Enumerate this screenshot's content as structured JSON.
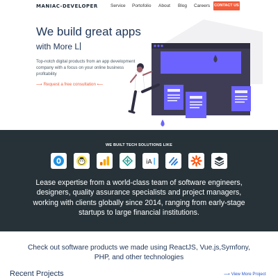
{
  "nav": {
    "brand": "MANIAC-DEVELOPER",
    "links": [
      "Service",
      "Portofolio",
      "About",
      "Blog",
      "Careers"
    ],
    "cta": "CONTACT US"
  },
  "hero": {
    "title": "We build great apps",
    "subtitle": "with More L",
    "description": "Top-notch digital products from an app development company with a focus on your online business profitability",
    "consult_link": "⟶ Request a free consultation ⟵"
  },
  "tech": {
    "heading": "WE BUILT TECH SOLUTIONS LIKE",
    "logos": [
      "dealerinspire-logo",
      "mailchimp-logo",
      "google-analytics-logo",
      "jsonformatter-logo",
      "ia-writer-logo",
      "blue-stripes-logo",
      "zapier-logo",
      "stack-logo"
    ],
    "text": "Lease expertise from a world-class team of software engineers, designers, quality assurance specialists and project managers, working with clients globally since 2014, ranging from early-stage startups to large financial institutions."
  },
  "products": {
    "text": "Check out software products we made using ReactJS, Vue.js,Symfony, PHP, and other technologies"
  },
  "recent": {
    "title": "Recent Projects",
    "view_more": "⟶ View More Project"
  },
  "colors": {
    "accent": "#f25c3b",
    "dark_bg": "#263238",
    "navy_text": "#1e3557",
    "illustration_purple": "#6c63ff"
  }
}
